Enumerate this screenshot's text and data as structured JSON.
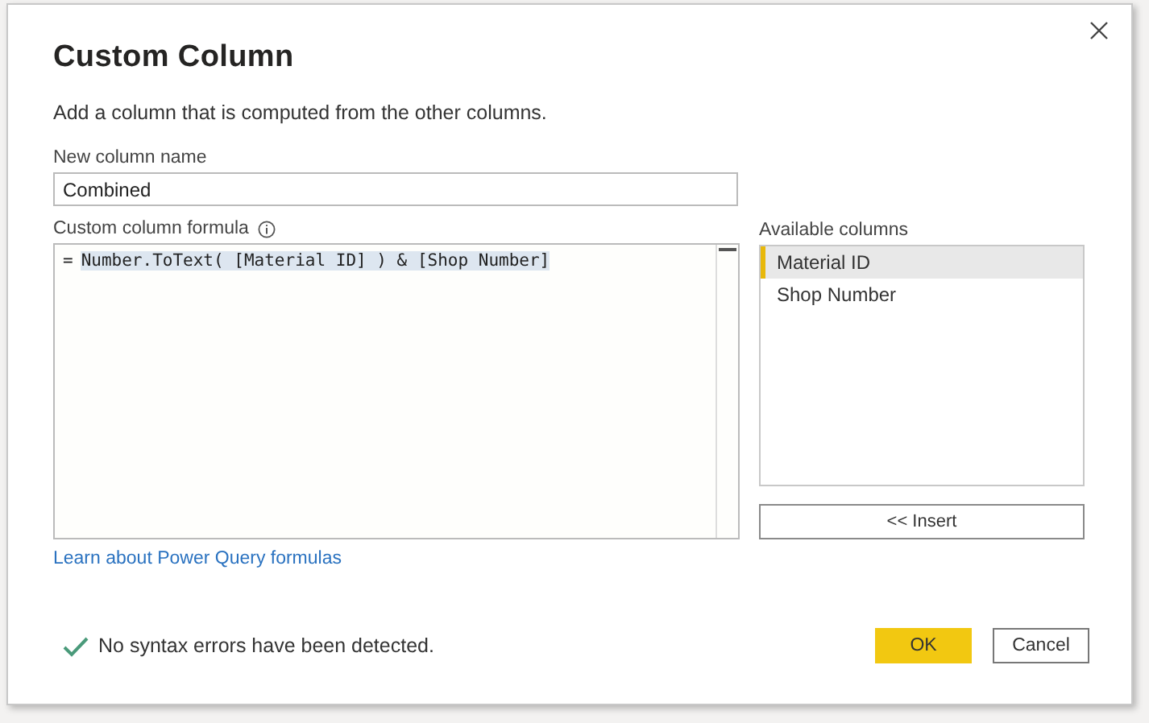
{
  "dialog": {
    "title": "Custom Column",
    "description": "Add a column that is computed from the other columns."
  },
  "name_field": {
    "label": "New column name",
    "value": "Combined"
  },
  "formula_field": {
    "label": "Custom column formula",
    "prefix": "=",
    "value": "Number.ToText( [Material ID] ) & [Shop Number]",
    "selected": true
  },
  "learn_link": "Learn about Power Query formulas",
  "available_columns": {
    "label": "Available columns",
    "items": [
      {
        "label": "Material ID",
        "selected": true
      },
      {
        "label": "Shop Number",
        "selected": false
      }
    ]
  },
  "insert_button": "<< Insert",
  "status": {
    "kind": "ok",
    "message": "No syntax errors have been detected."
  },
  "buttons": [
    {
      "label": "OK",
      "kind": "primary"
    },
    {
      "label": "Cancel",
      "kind": "secondary"
    }
  ]
}
